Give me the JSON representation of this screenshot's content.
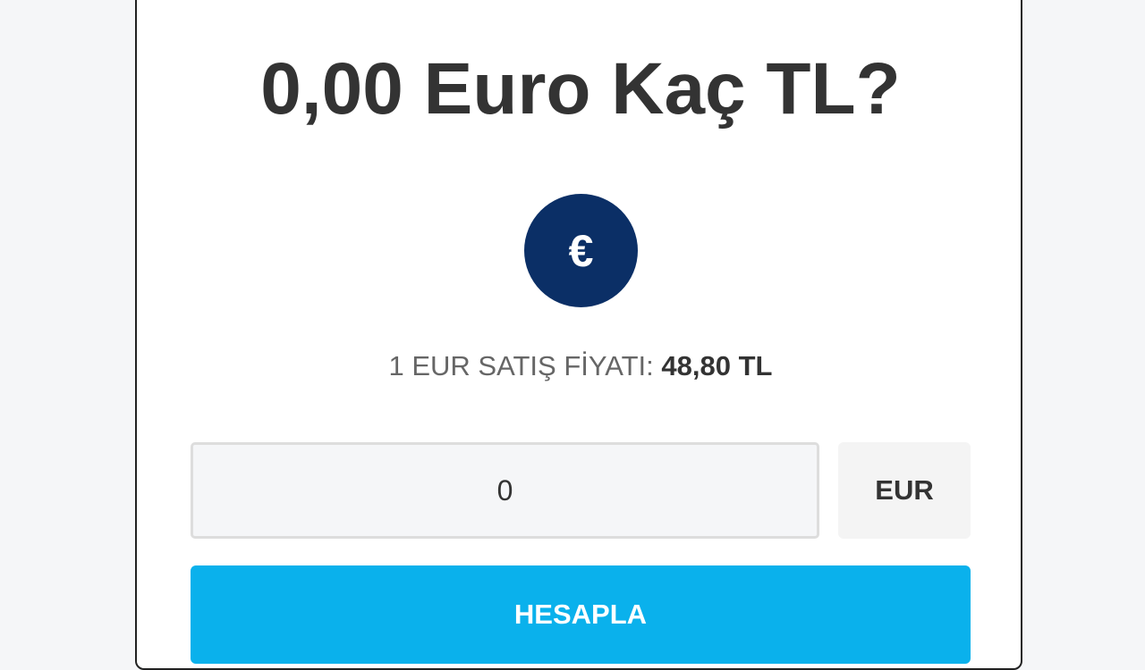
{
  "header": {
    "title": "0,00 Euro Kaç TL?"
  },
  "coin": {
    "icon": "euro-icon",
    "symbol": "€",
    "color": "#0b2f66"
  },
  "rate": {
    "label": "1 EUR SATIŞ FİYATI:",
    "value": "48,80 TL"
  },
  "converter": {
    "amount_value": "0",
    "currency_label": "EUR",
    "calculate_label": "HESAPLA",
    "accent_color": "#0ab1ec"
  }
}
